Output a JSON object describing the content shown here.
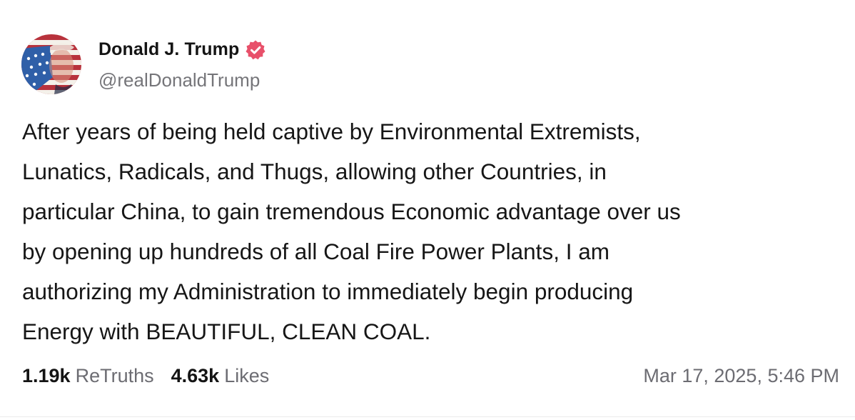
{
  "post": {
    "author": {
      "display_name": "Donald J. Trump",
      "handle": "@realDonaldTrump",
      "verified": true,
      "verified_icon": "verified-badge-icon",
      "avatar_icon": "avatar-flag-portrait"
    },
    "text": "After years of being held captive by Environmental Extremists,\nLunatics, Radicals, and Thugs, allowing other Countries, in\nparticular China, to gain tremendous Economic advantage over us\nby opening up hundreds of all Coal Fire Power Plants, I am\nauthorizing my Administration to immediately begin producing\nEnergy with BEAUTIFUL, CLEAN COAL.",
    "stats": {
      "retruths_count": "1.19k",
      "retruths_label": "ReTruths",
      "likes_count": "4.63k",
      "likes_label": "Likes"
    },
    "timestamp": "Mar 17, 2025, 5:46 PM"
  },
  "colors": {
    "text_primary": "#141414",
    "text_secondary": "#6c6c72",
    "verified_badge": "#e8506a",
    "background": "#ffffff"
  }
}
